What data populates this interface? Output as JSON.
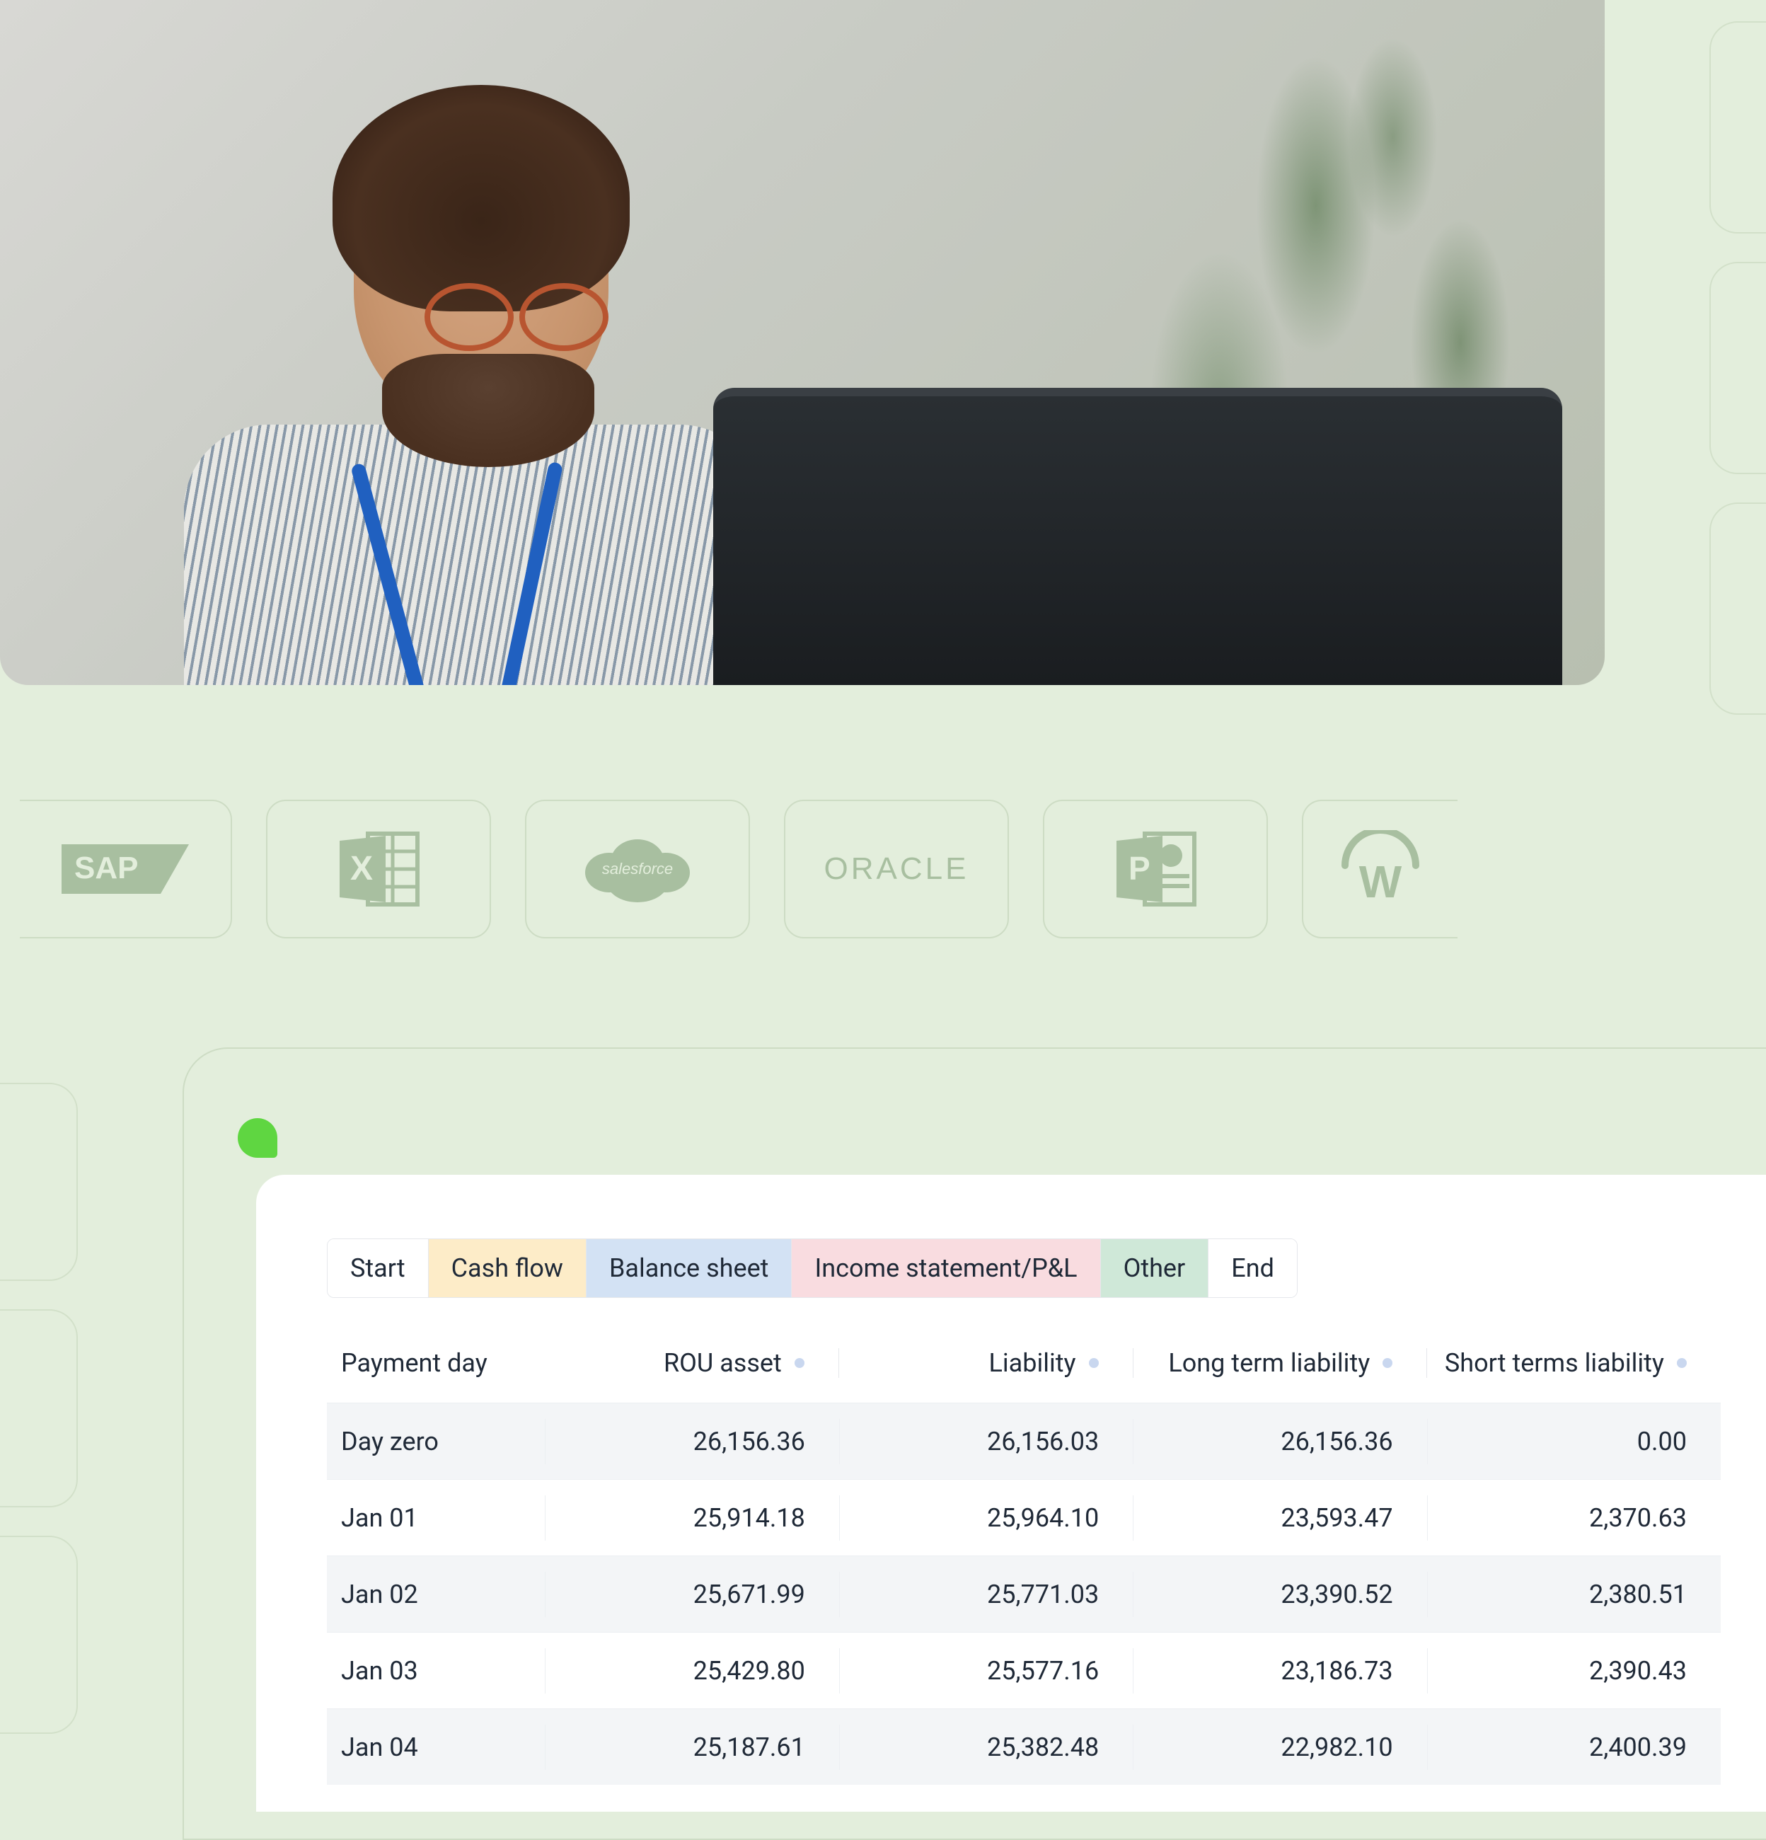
{
  "logos": {
    "sap": "SAP",
    "excel": "excel-icon",
    "salesforce": "salesforce",
    "oracle": "ORACLE",
    "powerpoint": "powerpoint-icon",
    "workday": "W"
  },
  "tabs": {
    "start": "Start",
    "cashflow": "Cash flow",
    "balance": "Balance sheet",
    "income": "Income statement/P&L",
    "other": "Other",
    "end": "End"
  },
  "table": {
    "headers": {
      "payment_day": "Payment day",
      "rou_asset": "ROU asset",
      "liability": "Liability",
      "long_term": "Long term liability",
      "short_term": "Short terms liability"
    },
    "rows": [
      {
        "pd": "Day zero",
        "rou": "26,156.36",
        "liab": "26,156.03",
        "lt": "26,156.36",
        "st": "0.00"
      },
      {
        "pd": "Jan 01",
        "rou": "25,914.18",
        "liab": "25,964.10",
        "lt": "23,593.47",
        "st": "2,370.63"
      },
      {
        "pd": "Jan 02",
        "rou": "25,671.99",
        "liab": "25,771.03",
        "lt": "23,390.52",
        "st": "2,380.51"
      },
      {
        "pd": "Jan 03",
        "rou": "25,429.80",
        "liab": "25,577.16",
        "lt": "23,186.73",
        "st": "2,390.43"
      },
      {
        "pd": "Jan 04",
        "rou": "25,187.61",
        "liab": "25,382.48",
        "lt": "22,982.10",
        "st": "2,400.39"
      }
    ]
  }
}
